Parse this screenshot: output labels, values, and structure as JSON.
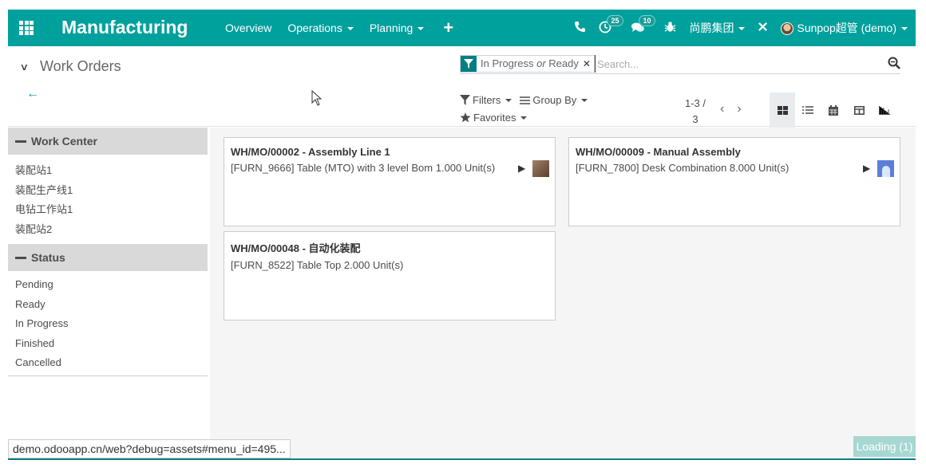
{
  "navbar": {
    "brand": "Manufacturing",
    "menu": [
      {
        "label": "Overview",
        "dropdown": false
      },
      {
        "label": "Operations",
        "dropdown": true
      },
      {
        "label": "Planning",
        "dropdown": true
      }
    ],
    "plus": "+",
    "activity_count": "25",
    "messages_count": "10",
    "company": "尚鹏集团",
    "user": "Sunpop超管 (demo)"
  },
  "breadcrumb": {
    "title": "Work Orders"
  },
  "search": {
    "facet_part1": "In Progress",
    "facet_or": "or",
    "facet_part2": "Ready",
    "placeholder": "Search..."
  },
  "controls": {
    "filters": "Filters",
    "group_by": "Group By",
    "favorites": "Favorites",
    "pager_range": "1-3 /",
    "pager_total": "3"
  },
  "sidebar": {
    "work_center_title": "Work Center",
    "work_centers": [
      "装配站1",
      "装配生产线1",
      "电钻工作站1",
      "装配站2"
    ],
    "status_title": "Status",
    "statuses": [
      "Pending",
      "Ready",
      "In Progress",
      "Finished",
      "Cancelled"
    ]
  },
  "cards": [
    {
      "title": "WH/MO/00002 - Assembly Line 1",
      "desc": "[FURN_9666] Table (MTO) with 3 level Bom  1.000 Unit(s)",
      "avatar": "photo"
    },
    {
      "title": "WH/MO/00009 - Manual Assembly",
      "desc": "[FURN_7800] Desk Combination  8.000 Unit(s)",
      "avatar": "default"
    },
    {
      "title": "WH/MO/00048 - 自动化装配",
      "desc": "[FURN_8522] Table Top  2.000 Unit(s)",
      "avatar": "none"
    }
  ],
  "statusbar": {
    "url": "demo.odooapp.cn/web?debug=assets#menu_id=495..."
  },
  "loading": "Loading (1)",
  "colors": {
    "brand": "#00a09d",
    "accent_dark": "#017e84"
  }
}
